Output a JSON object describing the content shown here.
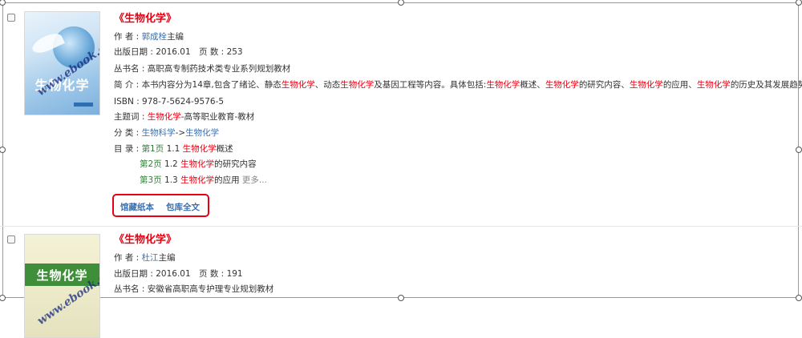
{
  "results": [
    {
      "title_open": "《",
      "title_keyword": "生物化学",
      "title_close": "》",
      "author_label": "作 者 : ",
      "author_name": "郭成栓",
      "author_role": "主编",
      "date_label": "出版日期 : ",
      "date_value": "2016.01",
      "pages_label": "页 数 : ",
      "pages_value": "253",
      "series_label": "丛书名 : ",
      "series_value": "高职高专制药技术类专业系列规划教材",
      "summary_label": "简 介 : ",
      "summary_parts": [
        "本书内容分为14章,包含了绪论、静态",
        "生物化学",
        "、动态",
        "生物化学",
        "及基因工程等内容。具体包括:",
        "生物化学",
        "概述、",
        "生物化学",
        "的研究内容、",
        "生物化学",
        "的应用、",
        "生物化学",
        "的历史及其发展趋势、糖类概"
      ],
      "isbn": "ISBN : 978-7-5624-9576-5",
      "subject_label": "主题词 : ",
      "subject_keyword": "生物化学",
      "subject_rest": "-高等职业教育-教材",
      "category_label": "分 类 : ",
      "category_a": "生物科学",
      "category_sep": "->",
      "category_b": "生物化学",
      "toc_label": "目 录 : ",
      "toc": [
        {
          "page": "第1页",
          "num": "1.1",
          "kw": "生物化学",
          "rest": "概述"
        },
        {
          "page": "第2页",
          "num": "1.2",
          "kw": "生物化学",
          "rest": "的研究内容"
        },
        {
          "page": "第3页",
          "num": "1.3",
          "kw": "生物化学",
          "rest": "的应用"
        }
      ],
      "more": "更多...",
      "action_paper": "馆藏纸本",
      "action_fulltext": "包库全文",
      "cover_title": "生物化学",
      "watermark": "www.ebook.com"
    },
    {
      "title_open": "《",
      "title_keyword": "生物化学",
      "title_close": "》",
      "author_label": "作 者 : ",
      "author_name": "杜江",
      "author_role": "主编",
      "date_label": "出版日期 : ",
      "date_value": "2016.01",
      "pages_label": "页 数 : ",
      "pages_value": "191",
      "series_label": "丛书名 : ",
      "series_value": "安徽省高职高专护理专业规划教材",
      "cover_title": "生物化学",
      "watermark": "www.ebook.com"
    }
  ]
}
